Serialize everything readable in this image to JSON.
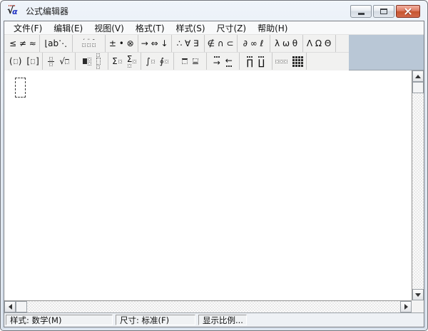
{
  "window": {
    "title": "公式编辑器"
  },
  "app_icon": {
    "radical": "√",
    "alpha": "α"
  },
  "menu": {
    "items": [
      "文件(F)",
      "编辑(E)",
      "视图(V)",
      "格式(T)",
      "样式(S)",
      "尺寸(Z)",
      "帮助(H)"
    ]
  },
  "row1": [
    {
      "icon": "relational-symbols-icon",
      "text": "≤ ≠ ≈"
    },
    {
      "icon": "spaces-ellipses-icon",
      "text": "⌊ab⋱"
    },
    {
      "icon": "embellishments-icon",
      "marks": [
        "ˊ",
        "¨",
        "ˉ"
      ]
    },
    {
      "icon": "operator-symbols-icon",
      "text": "± • ⊗"
    },
    {
      "icon": "arrow-symbols-icon",
      "text": "→ ⇔ ↓"
    },
    {
      "icon": "logical-symbols-icon",
      "text": "∴ ∀ ∃"
    },
    {
      "icon": "set-theory-symbols-icon",
      "text": "∉ ∩ ⊂"
    },
    {
      "icon": "misc-symbols-icon",
      "text": "∂ ∞ ℓ"
    },
    {
      "icon": "greek-lowercase-icon",
      "text": "λ ω θ"
    },
    {
      "icon": "greek-uppercase-icon",
      "text": "Λ Ω Θ"
    }
  ],
  "row2": {
    "fence_open_paren": "(",
    "fence_close_paren": ")",
    "fence_open_bracket": "[",
    "fence_close_bracket": "]",
    "radical": "√",
    "sum1": "Σ",
    "sum2": "Σ",
    "integral": "∫",
    "contour_integral": "∮",
    "arrow_right": "→",
    "arrow_left": "←",
    "product": "∏",
    "coproduct": "∐"
  },
  "status": {
    "style": "样式: 数学(M)",
    "size": "尺寸: 标准(F)",
    "zoom": "显示比例..."
  }
}
